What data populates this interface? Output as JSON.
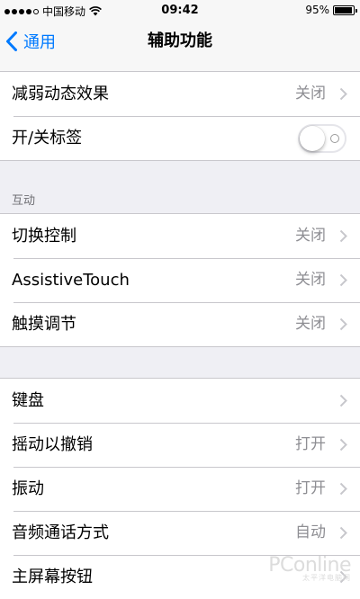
{
  "status_bar": {
    "signal_dots_filled": 4,
    "signal_dots_total": 5,
    "carrier": "中国移动",
    "time": "09:42",
    "battery_percent": "95%",
    "battery_level": 0.95
  },
  "nav": {
    "back_label": "通用",
    "title": "辅助功能"
  },
  "group1": {
    "rows": [
      {
        "label": "减弱动态效果",
        "value": "关闭"
      },
      {
        "label": "开/关标签",
        "toggle": false
      }
    ]
  },
  "group2": {
    "header": "互动",
    "rows": [
      {
        "label": "切换控制",
        "value": "关闭"
      },
      {
        "label": "AssistiveTouch",
        "value": "关闭"
      },
      {
        "label": "触摸调节",
        "value": "关闭"
      }
    ]
  },
  "group3": {
    "rows": [
      {
        "label": "键盘",
        "value": ""
      },
      {
        "label": "摇动以撤销",
        "value": "打开"
      },
      {
        "label": "振动",
        "value": "打开"
      },
      {
        "label": "音频通话方式",
        "value": "自动"
      },
      {
        "label": "主屏幕按钮",
        "value": ""
      }
    ]
  },
  "watermark": {
    "main": "PConline",
    "sub": "太平洋电脑网"
  },
  "colors": {
    "accent": "#007aff",
    "background": "#efeff4",
    "secondary_text": "#8e8e93",
    "separator": "#c8c7cc"
  }
}
